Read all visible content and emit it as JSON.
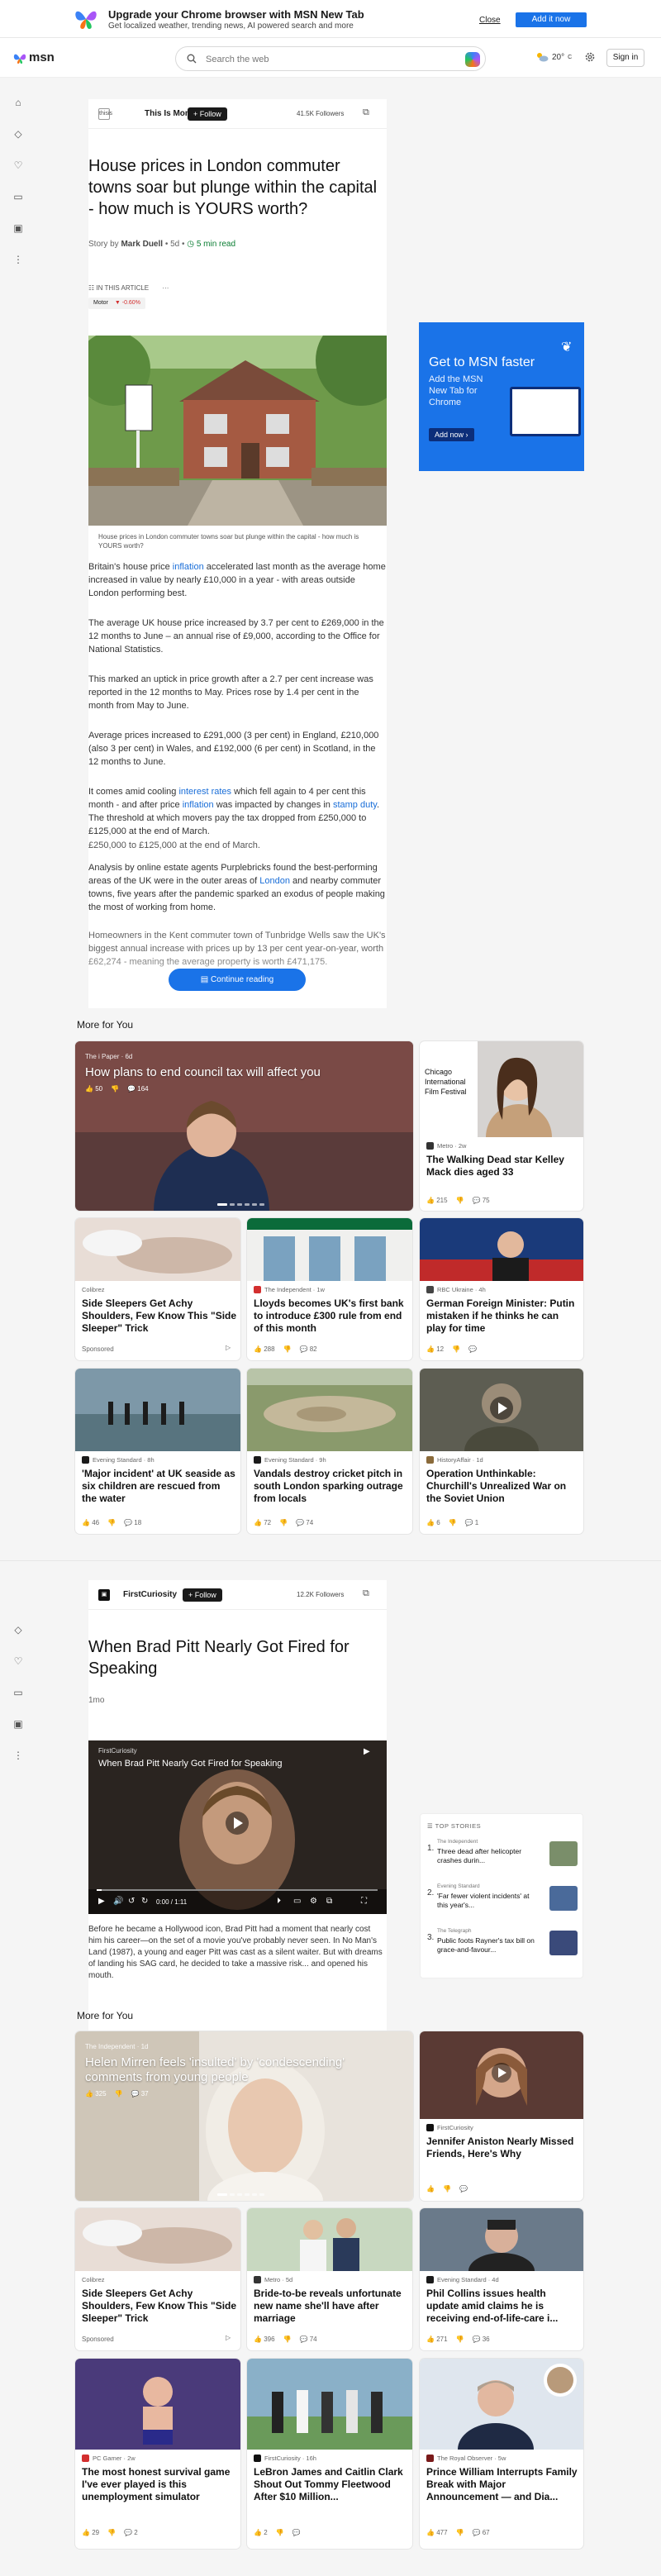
{
  "banner": {
    "title": "Upgrade your Chrome browser with MSN New Tab",
    "subtitle": "Get localized weather, trending news, AI powered search and more",
    "close_label": "Close",
    "add_label": "Add it now"
  },
  "topbar": {
    "logo": "msn",
    "search_placeholder": "Search the web",
    "temperature": "20°",
    "temp_unit": "C",
    "signin_label": "Sign in"
  },
  "article1": {
    "publisher": "This Is Money",
    "publisher_short": "thisis",
    "follow_label": "+ Follow",
    "followers": "41.5K Followers",
    "title": "House prices in London commuter towns soar but plunge within the capital - how much is YOURS worth?",
    "story_by": "Story by",
    "author": "Mark Duell",
    "age": " • 5d • ",
    "read_time": "5 min read",
    "toc_label": "IN THIS ARTICLE",
    "toc_chip_name": "Motor",
    "toc_chip_change": "▼ -0.60%",
    "caption": "House prices in London commuter towns soar but plunge within the capital - how much is YOURS worth?",
    "p1_a": "Britain's house price ",
    "p1_link": "inflation",
    "p1_b": " accelerated last month as the average home increased in value by nearly £10,000 in a year - with areas outside London performing best.",
    "p2": "The average UK house price increased by 3.7 per cent to £269,000 in the 12 months to June – an annual rise of £9,000, according to the Office for National Statistics.",
    "p3": "This marked an uptick in price growth after a 2.7 per cent increase was reported in the 12 months to May. Prices rose by 1.4 per cent in the month from May to June.",
    "p4": "Average prices increased to £291,000 (3 per cent) in England, £210,000 (also 3 per cent) in Wales, and £192,000 (6 per cent) in Scotland, in the 12 months to June.",
    "p5_a": "It comes amid cooling ",
    "p5_link1": "interest rates",
    "p5_b": " which fell again to 4 per cent this month - and after price ",
    "p5_link2": "inflation",
    "p5_c": " was impacted by changes in ",
    "p5_link3": "stamp duty",
    "p5_d": ". The threshold at which movers pay the tax dropped from £250,000 to £125,000 at the end of March.",
    "p6": "£250,000 to £125,000 at the end of March.",
    "p7_a": "Analysis by online estate agents Purplebricks found the best-performing areas of the UK were in the outer areas of ",
    "p7_link": "London",
    "p7_b": " and nearby commuter towns, five years after the pandemic sparked an exodus of people making the most of working from home.",
    "p8": "Homeowners in the Kent commuter town of Tunbridge Wells saw the UK's biggest annual increase with prices up by 13 per cent year-on-year, worth £62,274 - meaning the average property is worth £471,175.",
    "continue_label": "Continue reading"
  },
  "ad": {
    "heading": "Get to MSN faster",
    "sub": "Add the MSN New Tab for Chrome",
    "button": "Add now ›"
  },
  "more1": {
    "title": "More for You",
    "big": {
      "source": "The i Paper · 6d",
      "title": "How plans to end council tax will affect you",
      "likes": "50",
      "comments": "164"
    },
    "c2": {
      "source": "Metro · 2w",
      "title": "The Walking Dead star Kelley Mack dies aged 33",
      "likes": "215",
      "comments": "75"
    },
    "c3": {
      "source": "Colibrez",
      "title": "Side Sleepers Get Achy Shoulders, Few Know This \"Side Sleeper\" Trick",
      "sponsored": "Sponsored"
    },
    "c4": {
      "source": "The Independent · 1w",
      "title": "Lloyds becomes UK's first bank to introduce £300 rule from end of this month",
      "likes": "288",
      "comments": "82"
    },
    "c5": {
      "source": "RBC Ukraine · 4h",
      "title": "German Foreign Minister: Putin mistaken if he thinks he can play for time",
      "likes": "12",
      "comments": ""
    },
    "c6": {
      "source": "Evening Standard · 8h",
      "title": "'Major incident' at UK seaside as six children are rescued from the water",
      "likes": "46",
      "comments": "18"
    },
    "c7": {
      "source": "Evening Standard · 9h",
      "title": "Vandals destroy cricket pitch in south London sparking outrage from locals",
      "likes": "72",
      "comments": "74"
    },
    "c8": {
      "source": "HistoryAffair · 1d",
      "title": "Operation Unthinkable: Churchill's Unrealized War on the Soviet Union",
      "likes": "6",
      "comments": "1"
    }
  },
  "article2": {
    "publisher": "FirstCuriosity",
    "follow_label": "+ Follow",
    "followers": "12.2K Followers",
    "title": "When Brad Pitt Nearly Got Fired for Speaking",
    "age": "1mo",
    "video_source": "FirstCuriosity",
    "video_title": "When Brad Pitt Nearly Got Fired for Speaking",
    "video_time": "0:00 / 1:11",
    "body": "Before he became a Hollywood icon, Brad Pitt had a moment that nearly cost him his career—on the set of a movie you've probably never seen. In No Man's Land (1987), a young and eager Pitt was cast as a silent waiter. But with dreams of landing his SAG card, he decided to take a massive risk... and opened his mouth."
  },
  "topstories": {
    "heading": "TOP STORIES",
    "items": [
      {
        "n": "1.",
        "source": "The Independent",
        "title": "Three dead after helicopter crashes durin..."
      },
      {
        "n": "2.",
        "source": "Evening Standard",
        "title": "'Far fewer violent incidents' at this year's..."
      },
      {
        "n": "3.",
        "source": "The Telegraph",
        "title": "Public foots Rayner's tax bill on grace-and-favour..."
      }
    ]
  },
  "more2": {
    "title": "More for You",
    "big": {
      "source": "The Independent · 1d",
      "title": "Helen Mirren feels 'insulted' by 'condescending' comments from young people",
      "likes": "325",
      "comments": "37"
    },
    "c2": {
      "source": "FirstCuriosity",
      "title": "Jennifer Aniston Nearly Missed Friends, Here's Why"
    },
    "c3": {
      "source": "Colibrez",
      "title": "Side Sleepers Get Achy Shoulders, Few Know This \"Side Sleeper\" Trick",
      "sponsored": "Sponsored"
    },
    "c4": {
      "source": "Metro · 5d",
      "title": "Bride-to-be reveals unfortunate new name she'll have after marriage",
      "likes": "396",
      "comments": "74"
    },
    "c5": {
      "source": "Evening Standard · 4d",
      "title": "Phil Collins issues health update amid claims he is receiving end-of-life-care i...",
      "likes": "271",
      "comments": "36"
    },
    "c6": {
      "source": "PC Gamer · 2w",
      "title": "The most honest survival game I've ever played is this unemployment simulator",
      "likes": "29",
      "comments": "2"
    },
    "c7": {
      "source": "FirstCuriosity · 16h",
      "title": "LeBron James and Caitlin Clark Shout Out Tommy Fleetwood After $10 Million...",
      "likes": "2",
      "comments": ""
    },
    "c8": {
      "source": "The Royal Observer · 5w",
      "title": "Prince William Interrupts Family Break with Major Announcement — and Dia...",
      "likes": "477",
      "comments": "67"
    }
  }
}
